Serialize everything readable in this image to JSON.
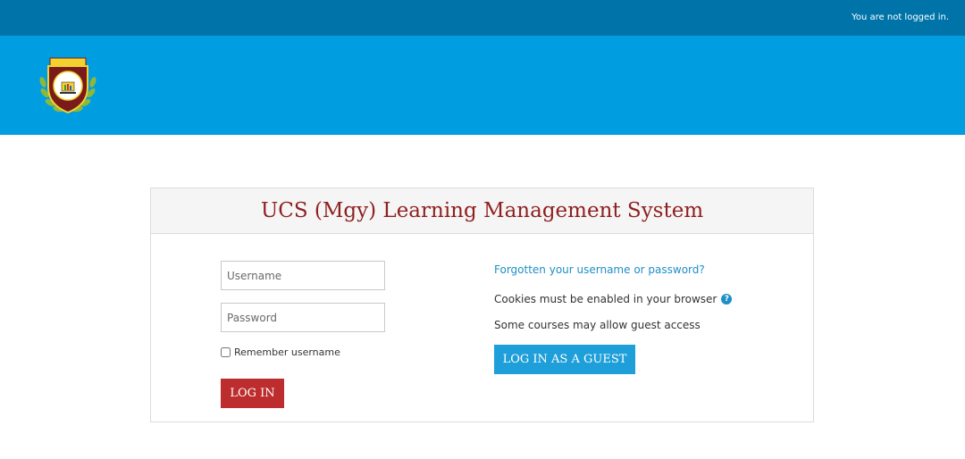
{
  "topbar": {
    "login_status": "You are not logged in."
  },
  "header": {
    "logo_name": "institution-crest-logo"
  },
  "login": {
    "title": "UCS (Mgy) Learning Management System",
    "username_placeholder": "Username",
    "password_placeholder": "Password",
    "remember_label": "Remember username",
    "login_button": "LOG IN",
    "forgot_link": "Forgotten your username or password?",
    "cookies_text": "Cookies must be enabled in your browser",
    "guest_text": "Some courses may allow guest access",
    "guest_button": "LOG IN AS A GUEST"
  },
  "colors": {
    "topbar": "#0074a8",
    "header": "#009ee0",
    "title": "#8f1f1f",
    "login_button": "#be2d2d",
    "guest_button": "#1e9fd9",
    "link": "#1e8fc6"
  },
  "icons": {
    "help": "question-circle-icon"
  }
}
